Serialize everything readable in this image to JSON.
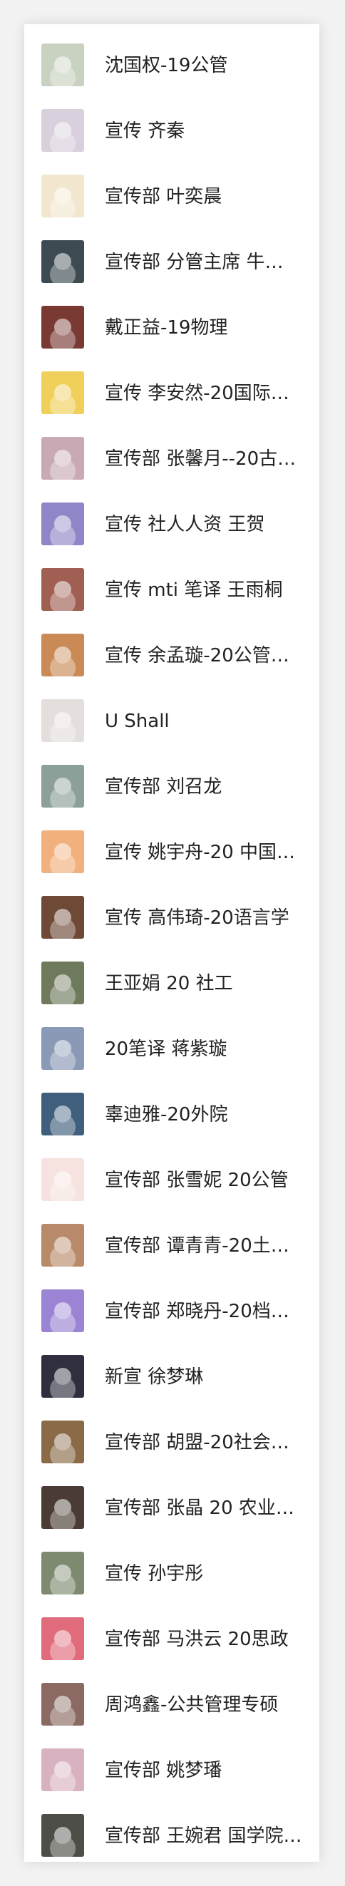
{
  "contacts": [
    {
      "name": "沈国权-19公管",
      "avatar_color": "#c9d2c0"
    },
    {
      "name": "宣传 齐秦",
      "avatar_color": "#d8d0dc"
    },
    {
      "name": "宣传部 叶奕晨",
      "avatar_color": "#f3e6cf"
    },
    {
      "name": "宣传部 分管主席 牛…",
      "avatar_color": "#3d4a52"
    },
    {
      "name": "戴正益-19物理",
      "avatar_color": "#7a3a34"
    },
    {
      "name": "宣传 李安然-20国际…",
      "avatar_color": "#f0cf5a"
    },
    {
      "name": "宣传部 张馨月--20古…",
      "avatar_color": "#c8a9b4"
    },
    {
      "name": "宣传 社人人资 王贺",
      "avatar_color": "#8f86c7"
    },
    {
      "name": "宣传 mti 笔译 王雨桐",
      "avatar_color": "#a05f52"
    },
    {
      "name": "宣传 余孟璇-20公管…",
      "avatar_color": "#c98a56"
    },
    {
      "name": "U Shall",
      "avatar_color": "#e4dedc"
    },
    {
      "name": "宣传部 刘召龙",
      "avatar_color": "#8c9f99"
    },
    {
      "name": "宣传 姚宇舟-20 中国…",
      "avatar_color": "#f1b07c"
    },
    {
      "name": "宣传 高伟琦-20语言学",
      "avatar_color": "#6e4a36"
    },
    {
      "name": "王亚娟 20 社工",
      "avatar_color": "#6f7a5d"
    },
    {
      "name": "20笔译 蒋紫璇",
      "avatar_color": "#8a99b6"
    },
    {
      "name": "辜迪雅-20外院",
      "avatar_color": "#3f5f7d"
    },
    {
      "name": "宣传部 张雪妮 20公管",
      "avatar_color": "#f6e3df"
    },
    {
      "name": "宣传部 谭青青-20土…",
      "avatar_color": "#b98a6a"
    },
    {
      "name": "宣传部 郑晓丹-20档…",
      "avatar_color": "#9c84d4"
    },
    {
      "name": "新宣 徐梦琳",
      "avatar_color": "#2f2f3f"
    },
    {
      "name": "宣传部 胡盟-20社会…",
      "avatar_color": "#8a6a47"
    },
    {
      "name": "宣传部 张晶 20 农业…",
      "avatar_color": "#4a3c34"
    },
    {
      "name": "宣传 孙宇彤",
      "avatar_color": "#7e8a70"
    },
    {
      "name": "宣传部 马洪云 20思政",
      "avatar_color": "#e06b7a"
    },
    {
      "name": "周鸿鑫-公共管理专硕",
      "avatar_color": "#8a6a63"
    },
    {
      "name": "宣传部 姚梦璠",
      "avatar_color": "#d9b2c1"
    },
    {
      "name": "宣传部 王婉君 国学院…",
      "avatar_color": "#4d4e47"
    }
  ]
}
